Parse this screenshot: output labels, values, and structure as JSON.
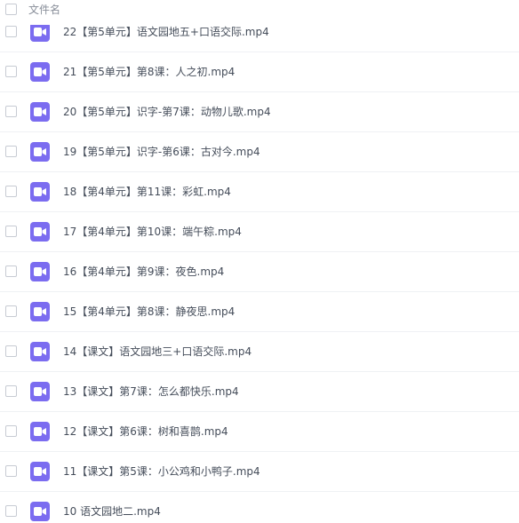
{
  "header": {
    "column_label": "文件名"
  },
  "files": [
    {
      "name": "22【第5单元】语文园地五+口语交际.mp4"
    },
    {
      "name": "21【第5单元】第8课：人之初.mp4"
    },
    {
      "name": "20【第5单元】识字-第7课：动物儿歌.mp4"
    },
    {
      "name": "19【第5单元】识字-第6课：古对今.mp4"
    },
    {
      "name": "18【第4单元】第11课：彩虹.mp4"
    },
    {
      "name": "17【第4单元】第10课：端午粽.mp4"
    },
    {
      "name": "16【第4单元】第9课：夜色.mp4"
    },
    {
      "name": "15【第4单元】第8课：静夜思.mp4"
    },
    {
      "name": "14【课文】语文园地三+口语交际.mp4"
    },
    {
      "name": "13【课文】第7课：怎么都快乐.mp4"
    },
    {
      "name": "12【课文】第6课：树和喜鹊.mp4"
    },
    {
      "name": "11【课文】第5课：小公鸡和小鸭子.mp4"
    },
    {
      "name": "10 语文园地二.mp4"
    }
  ],
  "colors": {
    "video_icon": "#7b6cf0",
    "row_divider": "#eff1f4",
    "checkbox_border": "#c7cbd3"
  },
  "icons": {
    "file_type": "video-file-icon"
  }
}
